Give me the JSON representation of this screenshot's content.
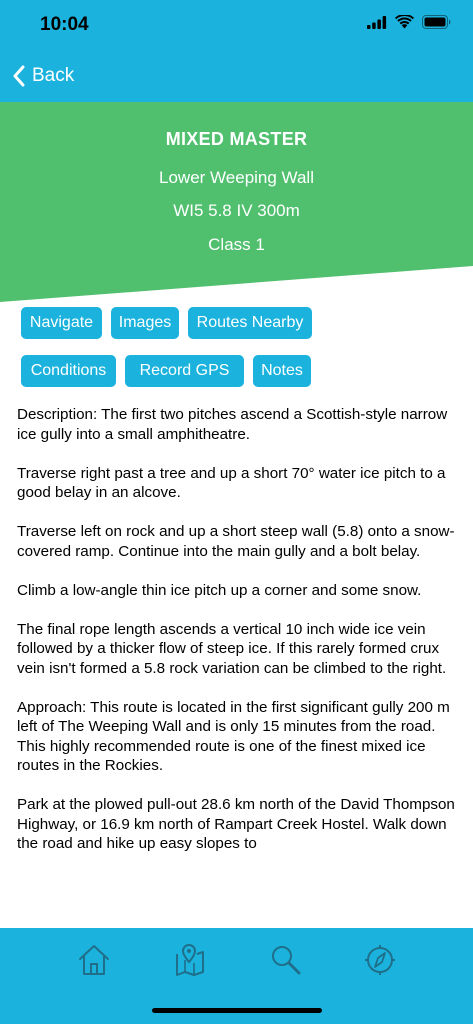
{
  "status_bar": {
    "time": "10:04"
  },
  "nav": {
    "back_label": "Back"
  },
  "route": {
    "name": "MIXED MASTER",
    "area": "Lower Weeping Wall",
    "grade": "WI5 5.8 IV 300m",
    "class": "Class 1"
  },
  "actions": {
    "navigate": "Navigate",
    "images": "Images",
    "routes_nearby": "Routes Nearby",
    "conditions": "Conditions",
    "record_gps": "Record GPS",
    "notes": "Notes"
  },
  "description": [
    "Description: The first two pitches ascend a Scottish-style narrow ice gully into a small amphitheatre.",
    "Traverse right past a tree and up a short 70° water ice pitch to a good belay in an alcove.",
    "Traverse left on rock and up a short steep wall (5.8) onto a snow-covered ramp. Continue into the main gully and a bolt belay.",
    "Climb a low-angle thin ice pitch up a corner and some snow.",
    "The final rope length ascends a vertical 10 inch wide ice vein followed by a thicker flow of steep ice. If this rarely formed crux vein isn't formed a 5.8 rock variation can be climbed to the right.",
    "Approach: This route is located in the first significant gully 200 m left of The Weeping Wall and is only 15 minutes from the road. This highly recommended route is one of the finest mixed ice routes in the Rockies.",
    "Park at the plowed pull-out 28.6 km north of the David Thompson Highway, or 16.9 km north of Rampart Creek Hostel. Walk down the road and hike up easy slopes to"
  ],
  "tab_bar": {
    "icons": [
      "home-icon",
      "map-icon",
      "search-icon",
      "compass-icon"
    ]
  },
  "colors": {
    "header_blue": "#1bb3dd",
    "hero_green": "#50c06f",
    "text": "#000000"
  }
}
